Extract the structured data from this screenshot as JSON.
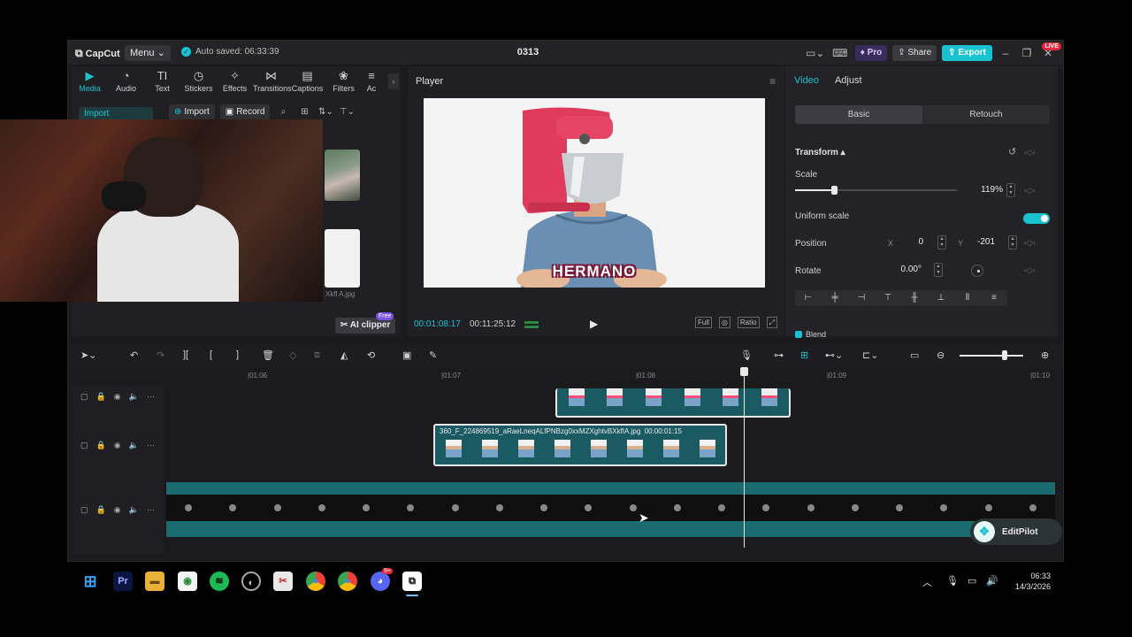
{
  "titlebar": {
    "logo": "CapCut",
    "menu_label": "Menu",
    "autosave": "Auto saved: 06:33:39",
    "project_title": "0313",
    "pro_label": "Pro",
    "share_label": "Share",
    "export_label": "Export",
    "live_badge": "LIVE"
  },
  "media": {
    "tabs": [
      {
        "label": "Media",
        "icon": "media-icon"
      },
      {
        "label": "Audio",
        "icon": "audio-icon"
      },
      {
        "label": "Text",
        "icon": "text-icon"
      },
      {
        "label": "Stickers",
        "icon": "stickers-icon"
      },
      {
        "label": "Effects",
        "icon": "effects-icon"
      },
      {
        "label": "Transitions",
        "icon": "transitions-icon"
      },
      {
        "label": "Captions",
        "icon": "captions-icon"
      },
      {
        "label": "Filters",
        "icon": "filters-icon"
      },
      {
        "label": "Ac",
        "icon": "adjustment-icon"
      }
    ],
    "side_import": "Import",
    "import_label": "Import",
    "record_label": "Record",
    "thumb_caption": "Xkfl A.jpg",
    "ai_clipper_label": "AI clipper",
    "free_badge": "Free"
  },
  "player": {
    "title": "Player",
    "caption": "HERMANO",
    "timecode_current": "00:01:08:17",
    "timecode_total": "00:11:25:12",
    "controls": [
      "Full",
      "Ratio"
    ]
  },
  "properties": {
    "tabs": [
      "Video",
      "Adjust"
    ],
    "segments": [
      "Basic",
      "Retouch"
    ],
    "transform_title": "Transform",
    "scale_label": "Scale",
    "scale_value": "119%",
    "scale_fraction": 0.24,
    "uniform_scale_label": "Uniform scale",
    "uniform_scale_on": true,
    "position_label": "Position",
    "x_label": "X",
    "x_value": "0",
    "y_label": "Y",
    "y_value": "-201",
    "rotate_label": "Rotate",
    "rotate_value": "0.00°",
    "next_section": "Blend"
  },
  "timeline": {
    "ruler": [
      "|01:06",
      "|01:07",
      "|01:08",
      "|01:09",
      "|01:10"
    ],
    "clip_file": "360_F_224869519_aRaeLneqALfPNBzg0xxMZXghtvBXkfIA.jpg",
    "clip_duration": "00:00:01:15",
    "editpilot_label": "EditPilot"
  },
  "taskbar": {
    "time": "06:33",
    "date": "14/3/2026",
    "discord_badge": "9+"
  },
  "colors": {
    "accent": "#19c2d1",
    "pro": "#3a2c5a",
    "live": "#e6283c"
  }
}
